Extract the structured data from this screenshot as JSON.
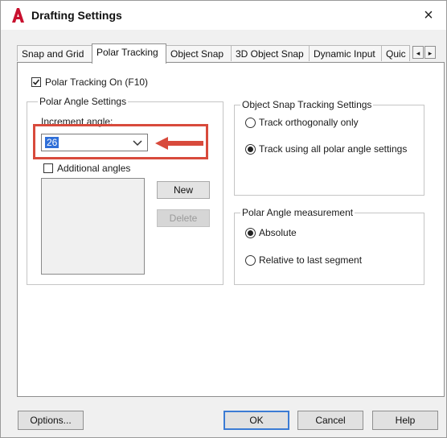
{
  "window": {
    "title": "Drafting Settings",
    "close_glyph": "×"
  },
  "tabs": [
    {
      "label": "Snap and Grid"
    },
    {
      "label": "Polar Tracking",
      "active": true
    },
    {
      "label": "Object Snap"
    },
    {
      "label": "3D Object Snap"
    },
    {
      "label": "Dynamic Input"
    },
    {
      "label": "Quic"
    }
  ],
  "tab_scroll": {
    "left": "◂",
    "right": "▸"
  },
  "polar_tracking_on": {
    "label": "Polar Tracking On (F10)",
    "checked": true
  },
  "polar_angle_settings": {
    "title": "Polar Angle Settings",
    "increment_label": "Increment angle:",
    "increment_value": "26",
    "additional_angles_label": "Additional angles",
    "additional_angles_checked": false,
    "new_button": "New",
    "delete_button": "Delete"
  },
  "object_snap_tracking": {
    "title": "Object Snap Tracking Settings",
    "options": [
      {
        "label": "Track orthogonally only",
        "selected": false
      },
      {
        "label": "Track using all polar angle settings",
        "selected": true
      }
    ]
  },
  "polar_angle_measurement": {
    "title": "Polar Angle measurement",
    "options": [
      {
        "label": "Absolute",
        "selected": true
      },
      {
        "label": "Relative to last segment",
        "selected": false
      }
    ]
  },
  "footer": {
    "options": "Options...",
    "ok": "OK",
    "cancel": "Cancel",
    "help": "Help"
  },
  "colors": {
    "highlight": "#d84a3c",
    "selection": "#2f6fd8",
    "app_icon": "#c8102e"
  },
  "icons": {
    "app": "autocad-a-icon",
    "close": "close-icon",
    "chevron": "chevron-down-icon",
    "arrow": "red-arrow-left-icon"
  }
}
